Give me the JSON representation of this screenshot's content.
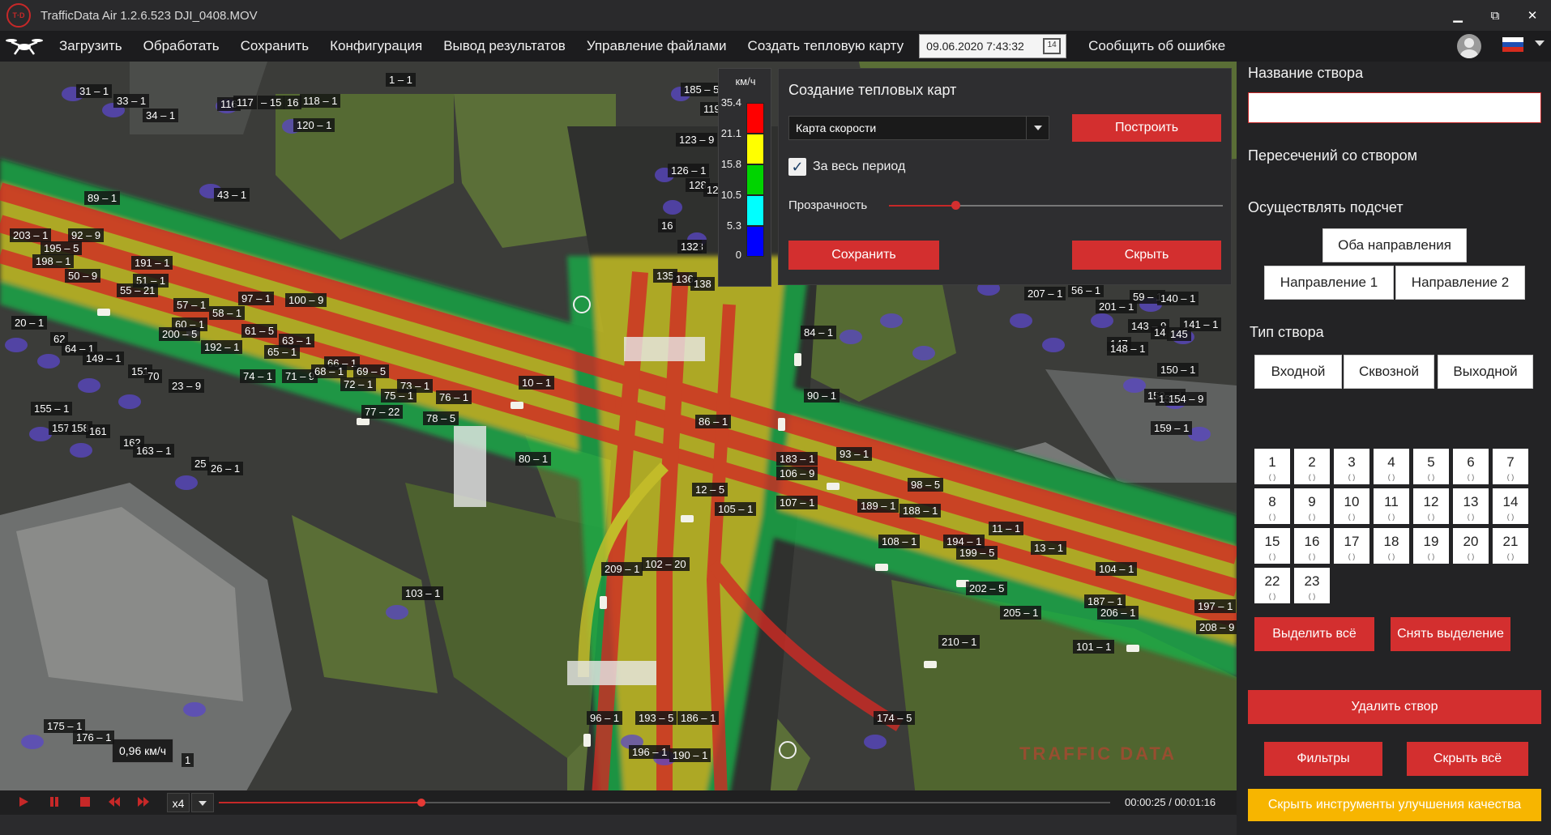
{
  "titlebar": {
    "logo_text": "T·D",
    "title": "TrafficData Air 1.2.6.523 DJI_0408.MOV",
    "minimize": "▁",
    "restore": "⧉",
    "close": "✕"
  },
  "menu": {
    "items": [
      "Загрузить",
      "Обработать",
      "Сохранить",
      "Конфигурация",
      "Вывод результатов",
      "Управление файлами",
      "Создать тепловую карту"
    ],
    "datetime": "09.06.2020 7:43:32",
    "calendar_day": "14",
    "report_bug": "Сообщить об ошибке"
  },
  "legend": {
    "unit": "км/ч",
    "ticks": [
      "35.4",
      "21.1",
      "15.8",
      "10.5",
      "5.3",
      "0"
    ]
  },
  "heatmap_panel": {
    "title": "Создание тепловых карт",
    "map_type": "Карта скорости",
    "build_button": "Построить",
    "whole_period_label": "За весь период",
    "whole_period_checked": true,
    "transparency_label": "Прозрачность",
    "transparency_value": 0.2,
    "save_button": "Сохранить",
    "hide_button": "Скрыть"
  },
  "video": {
    "speed_tooltip": "0,96 км/ч",
    "watermark": "TRAFFIC DATA",
    "track_labels": [
      "1 – 1",
      "31 – 1",
      "33 – 1",
      "34 – 1",
      "116",
      "117",
      "– 15",
      "16",
      "118 – 1",
      "120 – 1",
      "185 – 5",
      "119",
      "123 – 9",
      "126 – 1",
      "128",
      "12",
      "16",
      "133",
      "132",
      "135",
      "136",
      "138",
      "89 – 1",
      "43 – 1",
      "203 – 1",
      "92 – 9",
      "195 – 5",
      "198 – 1",
      "191 – 1",
      "50 – 9",
      "51 – 1",
      "55 – 21",
      "57 – 1",
      "97 – 1",
      "100 – 9",
      "58 – 1",
      "60 – 1",
      "20 – 1",
      "62",
      "64 – 1",
      "200 – 5",
      "192 – 1",
      "61 – 5",
      "63 – 1",
      "65 – 1",
      "149 – 1",
      "151",
      "70",
      "74 – 1",
      "71 – 9",
      "66 – 1",
      "68 – 1",
      "69 – 5",
      "72 – 1",
      "73 – 1",
      "23 – 9",
      "75 – 1",
      "76 – 1",
      "77 – 22",
      "78 – 5",
      "155 – 1",
      "157",
      "158",
      "161",
      "162",
      "163 – 1",
      "25",
      "26 – 1",
      "10 – 1",
      "80 – 1",
      "86 – 1",
      "84 – 1",
      "90 – 1",
      "93 – 1",
      "183 – 1",
      "106 – 9",
      "12 – 5",
      "105 – 1",
      "107 – 1",
      "98 – 5",
      "189 – 1",
      "188 – 1",
      "108 – 1",
      "11 – 1",
      "194 – 1",
      "199 – 5",
      "13 – 1",
      "104 – 1",
      "202 – 5",
      "187 – 1",
      "206 – 1",
      "205 – 1",
      "197 – 1",
      "208 – 9",
      "209 – 1",
      "102 – 20",
      "103 – 1",
      "210 – 1",
      "101 – 1",
      "207 – 1",
      "56 – 1",
      "201 – 1",
      "59 – 1",
      "140 – 1",
      "141 – 1",
      "143 – 9",
      "14",
      "145",
      "147",
      "148 – 1",
      "150 – 1",
      "152 – 1",
      "153",
      "154 – 9",
      "159 – 1",
      "96 – 1",
      "193 – 5",
      "186 – 1",
      "196 – 1",
      "190 – 1",
      "174 – 5",
      "175 – 1",
      "176 – 1",
      "1"
    ]
  },
  "player": {
    "speed": "x4",
    "progress": 0.227,
    "current_time": "00:00:25",
    "separator": "/",
    "total_time": "00:01:16"
  },
  "sidebar": {
    "section_name_label": "Название створа",
    "name_value": "",
    "intersections_label": "Пересечений со створом",
    "count_label": "Осуществлять подсчет",
    "both_directions": "Оба направления",
    "direction1": "Направление 1",
    "direction2": "Направление 2",
    "section_type_label": "Тип створа",
    "type_in": "Входной",
    "type_through": "Сквозной",
    "type_out": "Выходной",
    "numbers": [
      "1",
      "2",
      "3",
      "4",
      "5",
      "6",
      "7",
      "8",
      "9",
      "10",
      "11",
      "12",
      "13",
      "14",
      "15",
      "16",
      "17",
      "18",
      "19",
      "20",
      "21",
      "22",
      "23"
    ],
    "number_sub": "( )",
    "select_all": "Выделить всё",
    "deselect": "Снять выделение",
    "delete_section": "Удалить створ",
    "filters": "Фильтры",
    "hide_all": "Скрыть всё",
    "hide_quality_tools": "Скрыть инструменты улучшения качества"
  },
  "colors": {
    "accent_red": "#d32f2f",
    "accent_yellow": "#f7b500",
    "panel_bg": "#2e2e30"
  }
}
